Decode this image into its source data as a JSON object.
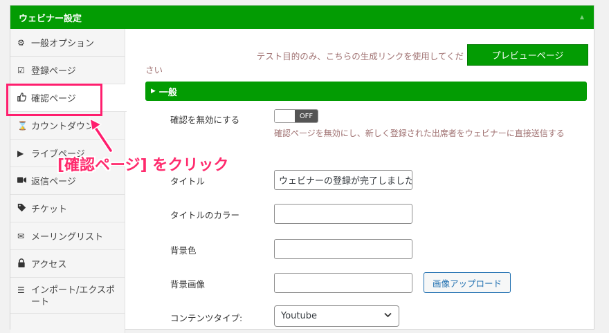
{
  "panel": {
    "title": "ウェビナー設定",
    "collapse_icon": "triangle-up-icon"
  },
  "sidebar": {
    "items": [
      {
        "icon": "gear-icon",
        "label": "一般オプション"
      },
      {
        "icon": "check-square-icon",
        "label": "登録ページ"
      },
      {
        "icon": "thumbs-up-icon",
        "label": "確認ページ"
      },
      {
        "icon": "hourglass-icon",
        "label": "カウントダウン"
      },
      {
        "icon": "play-icon",
        "label": "ライブページ"
      },
      {
        "icon": "video-camera-icon",
        "label": "返信ページ"
      },
      {
        "icon": "tag-icon",
        "label": "チケット"
      },
      {
        "icon": "envelope-icon",
        "label": "メーリングリスト"
      },
      {
        "icon": "lock-icon",
        "label": "アクセス"
      },
      {
        "icon": "list-icon",
        "label": "インポート/エクスポート"
      }
    ]
  },
  "preview": {
    "note_line1": "テスト目的のみ、こちらの生成リンクを使用してくだ",
    "note_line2": "さい",
    "button_label": "プレビューページ"
  },
  "section": {
    "title": "一般"
  },
  "form": {
    "disable_label": "確認を無効にする",
    "toggle_state": "OFF",
    "disable_help": "確認ページを無効にし、新しく登録された出席者をウェビナーに直接送信する",
    "title_label": "タイトル",
    "title_value": "ウェビナーの登録が完了しました",
    "title_color_label": "タイトルのカラー",
    "bg_color_label": "背景色",
    "bg_image_label": "背景画像",
    "upload_button_label": "画像アップロード",
    "content_type_label": "コンテンツタイプ:",
    "content_type_value": "Youtube"
  },
  "annotation": {
    "callout_text": "[確認ページ] をクリック",
    "color": "#ff1e6e"
  },
  "colors": {
    "brand_green": "#039c03",
    "note_text": "#a07272",
    "link_blue": "#2271b1"
  }
}
